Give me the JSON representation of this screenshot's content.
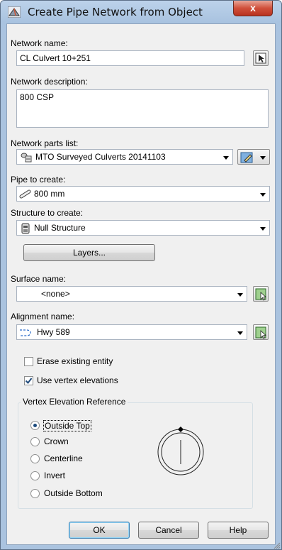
{
  "window": {
    "title": "Create Pipe Network from Object",
    "close_glyph": "x"
  },
  "network_name": {
    "label": "Network name:",
    "value": "CL Culvert 10+251"
  },
  "network_description": {
    "label": "Network description:",
    "value": "800 CSP"
  },
  "parts_list": {
    "label": "Network parts list:",
    "value": "MTO Surveyed Culverts 20141103"
  },
  "pipe": {
    "label": "Pipe to create:",
    "value": "800 mm"
  },
  "structure": {
    "label": "Structure to create:",
    "value": "Null Structure"
  },
  "layers_button": "Layers...",
  "surface": {
    "label": "Surface name:",
    "value": "<none>"
  },
  "alignment": {
    "label": "Alignment name:",
    "value": "Hwy 589"
  },
  "options": {
    "erase_label": "Erase existing entity",
    "erase_checked": false,
    "vertex_label": "Use vertex elevations",
    "vertex_checked": true
  },
  "vertex_reference": {
    "title": "Vertex Elevation Reference",
    "options": [
      "Outside Top",
      "Crown",
      "Centerline",
      "Invert",
      "Outside Bottom"
    ],
    "selected": "Outside Top"
  },
  "buttons": {
    "ok": "OK",
    "cancel": "Cancel",
    "help": "Help"
  },
  "icons": {
    "app": "pipe-network-app-icon",
    "pick": "pick-object-icon",
    "parts_list_edit": "edit-parts-list-icon",
    "pipe": "pipe-icon",
    "structure": "structure-icon",
    "alignment": "alignment-icon",
    "select_surface": "select-from-drawing-icon",
    "select_alignment": "select-from-drawing-icon"
  },
  "colors": {
    "default_button_border": "#3c7fb1",
    "close_button": "#c9462f"
  }
}
